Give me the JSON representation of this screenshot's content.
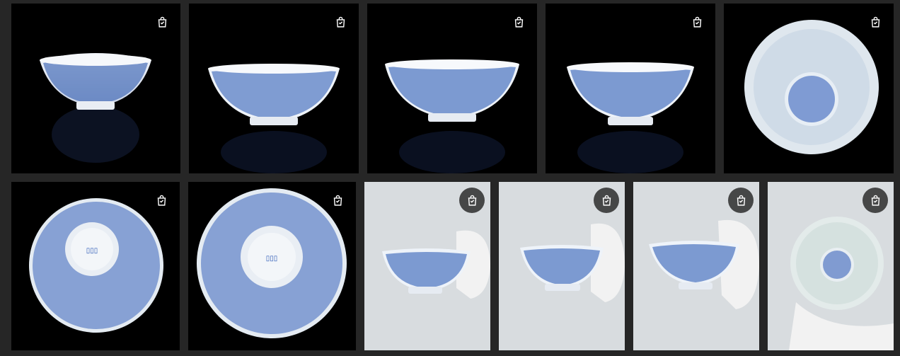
{
  "gallery": {
    "background": "#262626",
    "icon_name": "shopping-bag-icon",
    "row1": [
      {
        "id": "bowl-side-left",
        "bg": "#000000",
        "icon_style": "plain"
      },
      {
        "id": "bowl-side-2",
        "bg": "#000000",
        "icon_style": "plain"
      },
      {
        "id": "bowl-side-3",
        "bg": "#000000",
        "icon_style": "plain"
      },
      {
        "id": "bowl-side-4",
        "bg": "#000000",
        "icon_style": "plain"
      },
      {
        "id": "bowl-interior-top",
        "bg": "#000000",
        "icon_style": "plain"
      }
    ],
    "row2": [
      {
        "id": "bowl-base-mark-1",
        "bg": "#000000",
        "icon_style": "plain"
      },
      {
        "id": "bowl-base-mark-2",
        "bg": "#000000",
        "icon_style": "plain"
      },
      {
        "id": "bowl-in-hand-1",
        "bg": "#d8dcdf",
        "icon_style": "circle"
      },
      {
        "id": "bowl-in-hand-2",
        "bg": "#d8dcdf",
        "icon_style": "circle"
      },
      {
        "id": "bowl-in-hand-3",
        "bg": "#d8dcdf",
        "icon_style": "circle"
      },
      {
        "id": "bowl-in-hand-interior",
        "bg": "#d8dcdf",
        "icon_style": "circle"
      }
    ]
  }
}
